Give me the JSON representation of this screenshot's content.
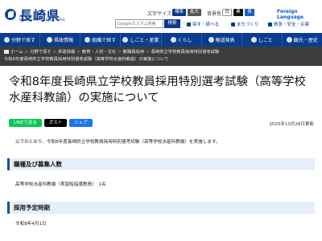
{
  "header": {
    "logo_text": "長崎県",
    "logo_sub": "NAGASAKI PREFECTURE",
    "font_size_label": "文字サイズ",
    "font_sizes": [
      "標準",
      "拡大"
    ],
    "bg_color_label": "背景色",
    "bg_colors": [
      "白",
      "黒",
      "青"
    ],
    "foreign_language": "Foreign Language",
    "search_placeholder": "Googleカスタム検索",
    "search_button": "検索",
    "utility_links": [
      "探す・調べる",
      "まちづくり",
      "救急・安全・災害"
    ]
  },
  "gnav": {
    "items": [
      "分野で探す",
      "県政情報",
      "組織で探す",
      "しごと・産業",
      "くらし",
      "報道発表",
      "しごと",
      "観光・歴史"
    ]
  },
  "breadcrumb": {
    "line1": [
      "ホーム",
      "分野で探す",
      "県政情報",
      "教育・人材・文化",
      "教職員採用",
      "長崎県立学校教員採用特別選考試験"
    ],
    "line2": "令和8年度長崎県立学校教員採用特別選考試験（高等学校水産科教諭）の実施について"
  },
  "page": {
    "title": "令和8年度長崎県立学校教員採用特別選考試験（高等学校水産科教諭）の実施について",
    "updated": "2025年10月28日更新",
    "share": {
      "line": "LINEで送る",
      "x": "ポスト",
      "facebook": "シェア"
    },
    "intro": "以下のとおり、令和8年度長崎県立学校教員採用特別選考試験（高等学校水産科教諭）を実施します。",
    "sections": [
      {
        "heading": "職種及び募集人数",
        "text": "高等学校水産科教諭（実習船指導教員）　1名"
      },
      {
        "heading": "採用予定時期",
        "text": "令和8年4月1日"
      }
    ]
  },
  "colors": {
    "nav_bg": "#0b3d8e",
    "breadcrumb_bg": "#3d3d3d",
    "section_head_bg": "#e6eef8",
    "line_green": "#06c755",
    "facebook_blue": "#1877f2"
  }
}
